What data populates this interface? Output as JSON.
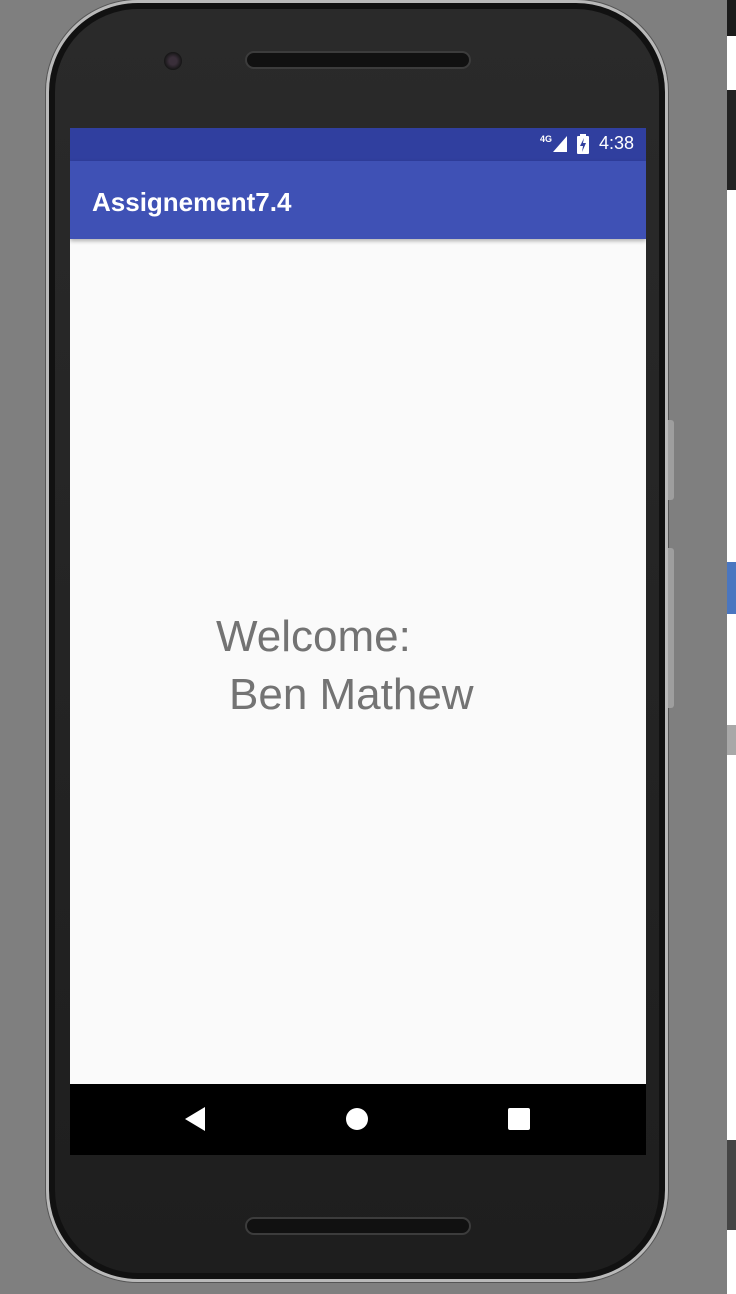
{
  "status_bar": {
    "network": "4G",
    "time": "4:38"
  },
  "app_bar": {
    "title": "Assignement7.4"
  },
  "content": {
    "welcome_label": "Welcome:",
    "user_name": "Ben Mathew"
  },
  "nav_bar": {
    "back_icon": "back-triangle-icon",
    "home_icon": "home-circle-icon",
    "recents_icon": "recents-square-icon"
  },
  "colors": {
    "status_bar": "#303f9f",
    "app_bar": "#3f51b5",
    "screen_background": "#fafafa",
    "text": "#737373"
  }
}
